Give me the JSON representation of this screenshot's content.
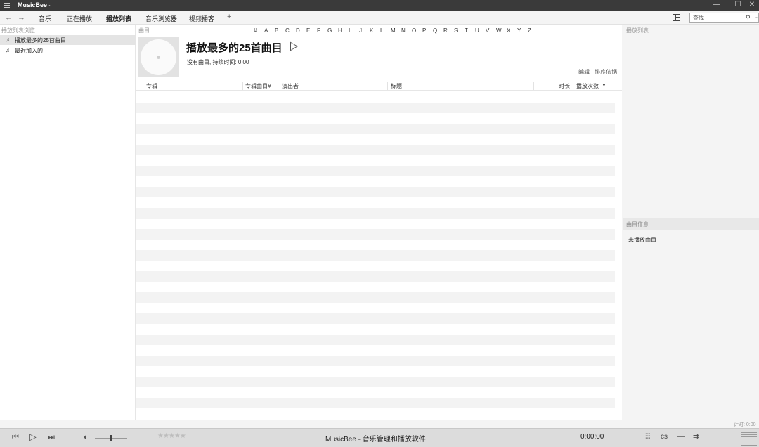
{
  "app": {
    "title": "MusicBee"
  },
  "tabs": [
    {
      "label": "音乐"
    },
    {
      "label": "正在播放"
    },
    {
      "label": "播放列表",
      "active": true
    },
    {
      "label": "音乐浏览器"
    },
    {
      "label": "视频播客"
    }
  ],
  "search": {
    "placeholder": "查找"
  },
  "left_panel": {
    "header": "播放列表浏览",
    "items": [
      {
        "label": "播放最多的25首曲目",
        "selected": true
      },
      {
        "label": "最近加入的"
      }
    ]
  },
  "main": {
    "header": "曲目",
    "alphabet": [
      "#",
      "A",
      "B",
      "C",
      "D",
      "E",
      "F",
      "G",
      "H",
      "I",
      "J",
      "K",
      "L",
      "M",
      "N",
      "O",
      "P",
      "Q",
      "R",
      "S",
      "T",
      "U",
      "V",
      "W",
      "X",
      "Y",
      "Z"
    ],
    "playlist_title": "播放最多的25首曲目",
    "playlist_summary": "没有曲目, 持续时间: 0:00",
    "edit_sort": "编辑 · 排序依据",
    "columns": [
      "专辑",
      "专辑曲目#",
      "演出者",
      "标题",
      "时长",
      "播放次数"
    ],
    "sorted_column": "播放次数"
  },
  "right_panel": {
    "header": "播放列表",
    "info_header": "曲目信息",
    "info_empty": "未播放曲目"
  },
  "status": {
    "timer": "计时: 0:00"
  },
  "player": {
    "now_playing": "MusicBee - 音乐管理和播放软件",
    "time": "0:00:00",
    "rating": 0
  },
  "colors": {
    "titlebar": "#3a3a3a",
    "player_bar": "#dcdcdc",
    "selection": "#e4e4e4"
  }
}
